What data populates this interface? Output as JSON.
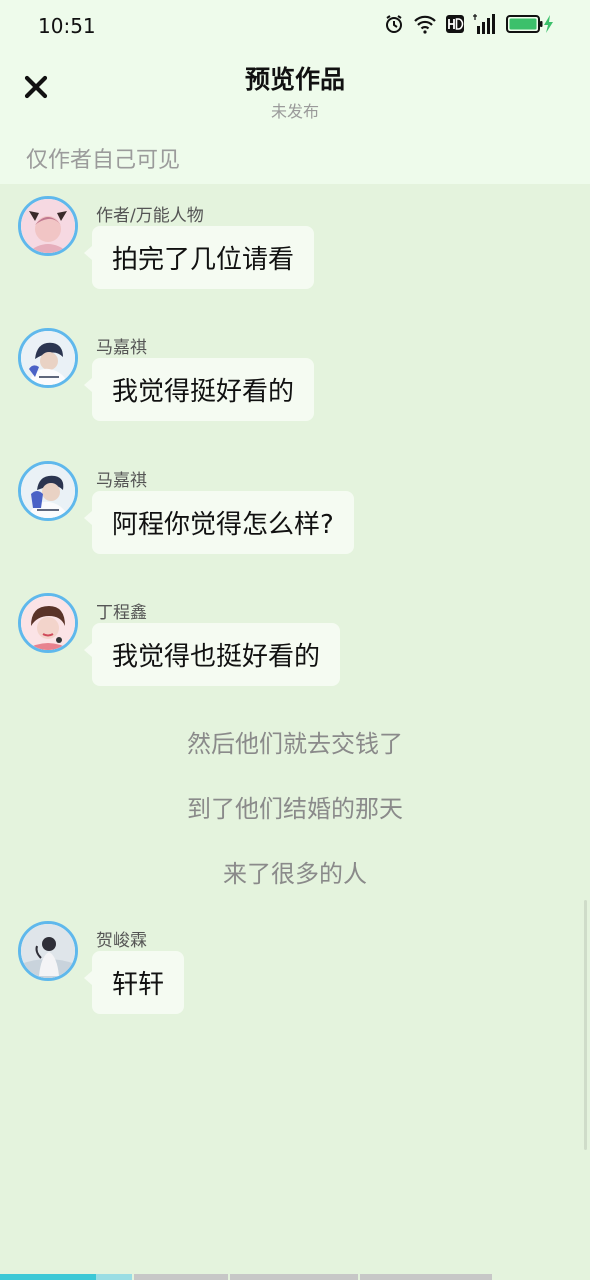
{
  "status_bar": {
    "time": "10:51",
    "battery_color": "#3cc06b"
  },
  "header": {
    "title": "预览作品",
    "subtitle": "未发布",
    "visibility_note": "仅作者自己可见"
  },
  "messages": [
    {
      "sender": "作者/万能人物",
      "text": "拍完了几位请看"
    },
    {
      "sender": "马嘉祺",
      "text": "我觉得挺好看的"
    },
    {
      "sender": "马嘉祺",
      "text": "阿程你觉得怎么样?"
    },
    {
      "sender": "丁程鑫",
      "text": "我觉得也挺好看的"
    },
    {
      "sender": "贺峻霖",
      "text": "轩轩"
    }
  ],
  "narrations": [
    "然后他们就去交钱了",
    "到了他们结婚的那天",
    "来了很多的人"
  ],
  "progress": {
    "filled_fraction": 0.22,
    "accent_color": "#3cc8d6"
  },
  "colors": {
    "background": "#e4f3dd",
    "header_bg": "#eefbeb",
    "avatar_border": "#5fb8ec"
  }
}
